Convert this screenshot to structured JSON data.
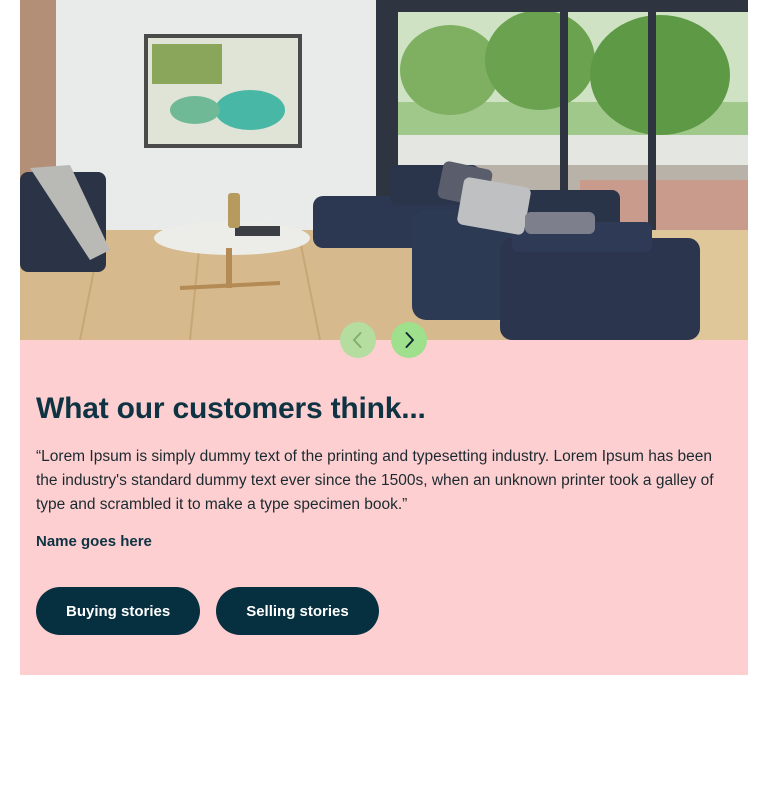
{
  "carousel": {
    "prev_label": "Previous",
    "next_label": "Next"
  },
  "testimonial": {
    "heading": "What our customers think...",
    "quote": "“Lorem Ipsum is simply dummy text of the printing and typesetting industry. Lorem Ipsum has been the industry's standard dummy text ever since the 1500s, when an unknown printer took a galley of type and scrambled it to make a type specimen book.”",
    "author": "Name goes here"
  },
  "actions": {
    "buying_label": "Buying stories",
    "selling_label": "Selling stories"
  },
  "colors": {
    "card_background": "#fdcfd0",
    "button_background": "#06303f",
    "carousel_accent": "#9fe08c"
  },
  "icons": {
    "prev": "chevron-left-icon",
    "next": "chevron-right-icon"
  }
}
